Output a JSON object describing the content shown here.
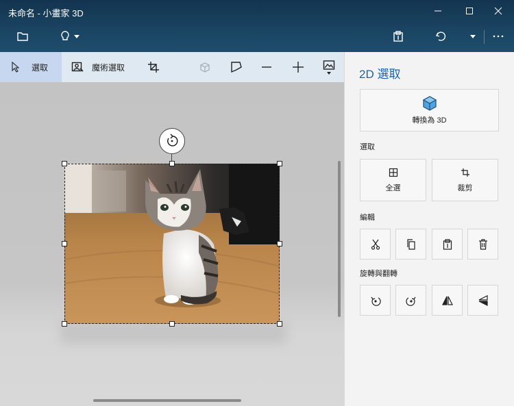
{
  "window": {
    "title": "未命名 - 小畫家 3D"
  },
  "appbar": {
    "menu_icon": "folder-icon",
    "brushes_icon": "lightbulb-icon",
    "paste_icon": "clipboard-icon",
    "undo_icon": "undo-icon",
    "more_icon": "more-icon"
  },
  "toolbar": {
    "select_label": "選取",
    "magic_select_label": "魔術選取"
  },
  "panel": {
    "title": "2D 選取",
    "convert_label": "轉換為 3D",
    "select_section": "選取",
    "select_all_label": "全選",
    "crop_label": "裁剪",
    "edit_section": "編輯",
    "rotate_section": "旋轉與翻轉"
  },
  "colors": {
    "title_bar": "#13344f",
    "accent": "#1d63a8",
    "toolbar_bg": "#dfe9f1",
    "panel_bg": "#f3f3f3"
  }
}
